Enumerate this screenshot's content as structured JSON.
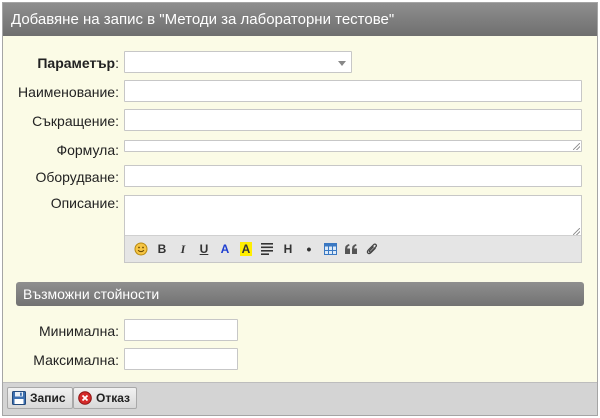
{
  "dialog": {
    "title": "Добавяне на запис в \"Методи за лабораторни тестове\""
  },
  "form": {
    "parameter": {
      "label": "Параметър",
      "colon": ":",
      "value": ""
    },
    "name": {
      "label": "Наименование:",
      "value": ""
    },
    "abbreviation": {
      "label": "Съкращение:",
      "value": ""
    },
    "formula": {
      "label": "Формула:",
      "value": ""
    },
    "equipment": {
      "label": "Оборудване:",
      "value": ""
    },
    "description": {
      "label": "Описание:",
      "value": ""
    }
  },
  "editor_toolbar": {
    "bold": "B",
    "italic": "I",
    "underline": "U",
    "text_color": "A",
    "highlight": "A",
    "heading": "H",
    "bullet": "•",
    "colors": {
      "text_color": "#1f3fd1",
      "highlight_bg": "#ffee00"
    }
  },
  "section": {
    "title": "Възможни стойности"
  },
  "values": {
    "min": {
      "label": "Минимална:",
      "value": ""
    },
    "max": {
      "label": "Максимална:",
      "value": ""
    }
  },
  "footer": {
    "save_label": "Запис",
    "cancel_label": "Отказ"
  },
  "icons": {
    "select": "chevron-down-icon",
    "emoji": "smiley-icon",
    "align": "align-justify-icon",
    "table": "table-icon",
    "quote": "quote-icon",
    "attach": "paperclip-icon",
    "save": "floppy-disk-icon",
    "cancel": "cancel-circle-icon"
  }
}
